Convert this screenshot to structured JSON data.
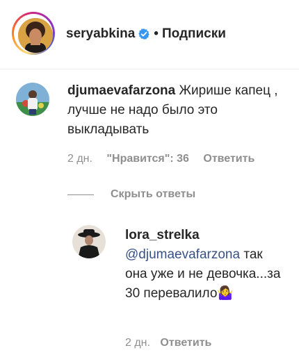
{
  "header": {
    "username": "seryabkina",
    "separator": "•",
    "follow_label": "Подписки"
  },
  "comment": {
    "username": "djumaevafarzona",
    "text": "Жирише капец , лучше не надо было это выкладывать",
    "time": "2 дн.",
    "likes": "\"Нравится\": 36",
    "reply_label": "Ответить"
  },
  "hide_replies_label": "Скрыть ответы",
  "reply": {
    "username": "lora_strelka",
    "mention": "@djumaevafarzona",
    "text": "так она уже и не девочка...за 30 перевалило🤷‍♀",
    "time": "2 дн.",
    "reply_label": "Ответить"
  },
  "colors": {
    "mention": "#385185",
    "meta": "#8e8e8e",
    "verified": "#3897f0"
  }
}
